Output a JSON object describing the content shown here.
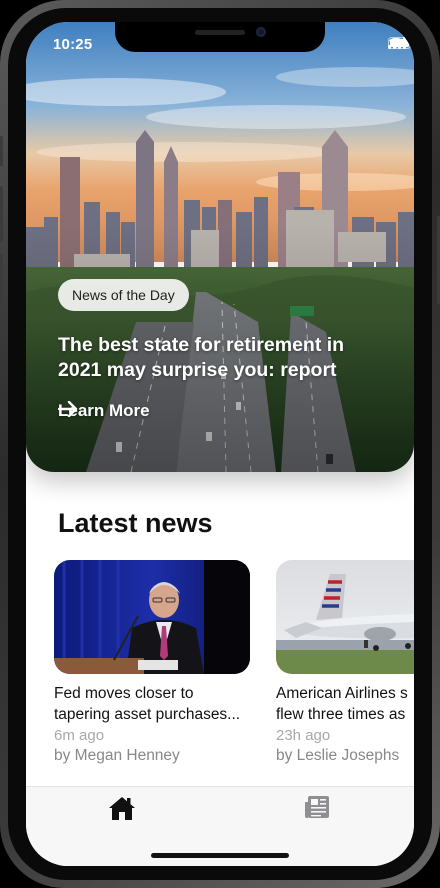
{
  "status_bar": {
    "time": "10:25"
  },
  "hero": {
    "tag": "News of the Day",
    "title_line1": "The best state for retirement in",
    "title_line2": "2021 may surprise you: report",
    "cta": "Learn More"
  },
  "latest": {
    "title": "Latest news",
    "items": [
      {
        "headline_line1": "Fed moves closer to",
        "headline_line2": "tapering asset purchases...",
        "time": "6m ago",
        "author": "by Megan Henney"
      },
      {
        "headline_line1": "American Airlines s",
        "headline_line2": "flew three times as",
        "time": "23h ago",
        "author": "by Leslie Josephs"
      }
    ]
  },
  "tabs": [
    {
      "icon": "home-icon",
      "active": true
    },
    {
      "icon": "newspaper-icon",
      "active": false
    }
  ],
  "colors": {
    "accent": "#111111",
    "inactive_tab": "#8e8e93"
  }
}
